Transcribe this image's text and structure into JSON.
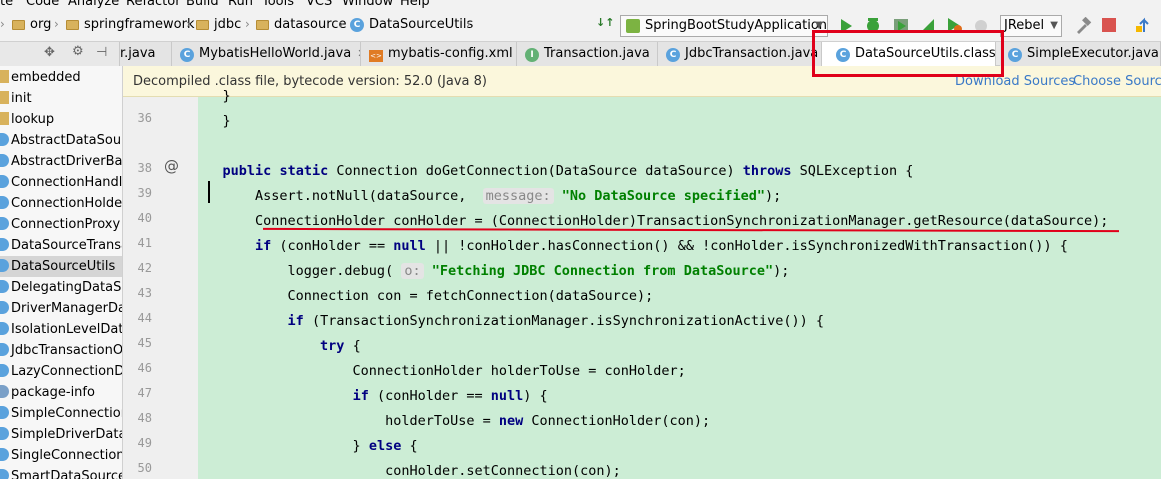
{
  "menu": [
    "te",
    "Code",
    "Analyze",
    "Refactor",
    "Build",
    "Run",
    "Tools",
    "VCS",
    "Window",
    "Help"
  ],
  "breadcrumb": [
    "org",
    "springframework",
    "jdbc",
    "datasource",
    "DataSourceUtils"
  ],
  "run_config": "SpringBootStudyApplication",
  "jrebel": "JRebel",
  "tabs": [
    {
      "label": "r.java",
      "icon": "java"
    },
    {
      "label": "MybatisHelloWorld.java",
      "icon": "class"
    },
    {
      "label": "mybatis-config.xml",
      "icon": "xml"
    },
    {
      "label": "Transaction.java",
      "icon": "interface"
    },
    {
      "label": "JdbcTransaction.java",
      "icon": "class"
    },
    {
      "label": "DataSourceUtils.class",
      "icon": "class",
      "active": true
    },
    {
      "label": "SimpleExecutor.java",
      "icon": "class"
    }
  ],
  "sidebar": [
    "embedded",
    "init",
    "lookup",
    "AbstractDataSource",
    "AbstractDriverBase",
    "ConnectionHandle",
    "ConnectionHolder",
    "ConnectionProxy",
    "DataSourceTransac",
    "DataSourceUtils",
    "DelegatingDataSou",
    "DriverManagerData",
    "IsolationLevelData",
    "JdbcTransactionOb",
    "LazyConnectionDat",
    "package-info",
    "SimpleConnectionH",
    "SimpleDriverDataSo",
    "SingleConnectionD",
    "SmartDataSource"
  ],
  "sidebar_selected": 9,
  "banner": {
    "message": "Decompiled .class file, bytecode version: 52.0 (Java 8)",
    "download": "Download Sources",
    "choose": "Choose Source"
  },
  "line_numbers": [
    "",
    "36",
    "",
    "38",
    "39",
    "40",
    "41",
    "42",
    "43",
    "44",
    "45",
    "46",
    "47",
    "48",
    "49",
    "50"
  ],
  "code_lines": [
    "    }",
    "    }",
    "",
    "    public static Connection doGetConnection(DataSource dataSource) throws SQLException {",
    "        Assert.notNull(dataSource,  message: \"No DataSource specified\");",
    "        ConnectionHolder conHolder = (ConnectionHolder)TransactionSynchronizationManager.getResource(dataSource);",
    "        if (conHolder == null || !conHolder.hasConnection() && !conHolder.isSynchronizedWithTransaction()) {",
    "            logger.debug( o: \"Fetching JDBC Connection from DataSource\");",
    "            Connection con = fetchConnection(dataSource);",
    "            if (TransactionSynchronizationManager.isSynchronizationActive()) {",
    "                try {",
    "                    ConnectionHolder holderToUse = conHolder;",
    "                    if (conHolder == null) {",
    "                        holderToUse = new ConnectionHolder(con);",
    "                    } else {",
    "                        conHolder.setConnection(con);"
  ],
  "colors": {
    "editor_bg": "#ccedd5",
    "highlight": "#e0001a",
    "keyword": "#000080",
    "string": "#008000"
  }
}
